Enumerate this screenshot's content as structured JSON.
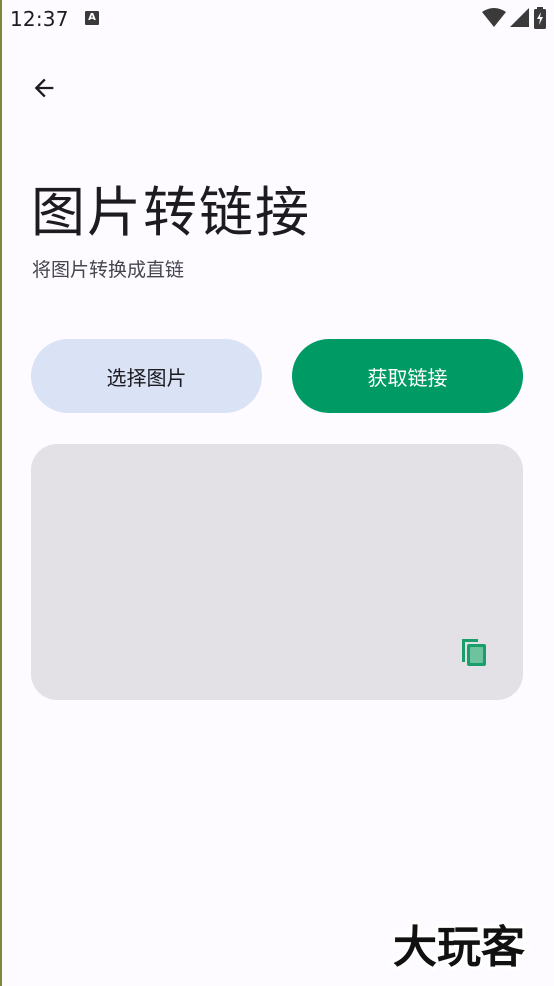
{
  "status_bar": {
    "time": "12:37",
    "notification_icon": "a-letter-icon",
    "icons": [
      "wifi-icon",
      "signal-icon",
      "battery-charging-icon"
    ]
  },
  "toolbar": {
    "back_icon": "arrow-left-icon"
  },
  "header": {
    "title": "图片转链接",
    "subtitle": "将图片转换成直链"
  },
  "actions": {
    "select_image_label": "选择图片",
    "get_link_label": "获取链接"
  },
  "result": {
    "link_text": "",
    "copy_icon": "copy-icon"
  },
  "colors": {
    "background": "#fdfbff",
    "select_button": "#dae2f6",
    "primary_button": "#009b64",
    "card": "#e4e1e6",
    "copy_icon": "#1a9e6b"
  },
  "watermark": {
    "text": "大玩客"
  }
}
